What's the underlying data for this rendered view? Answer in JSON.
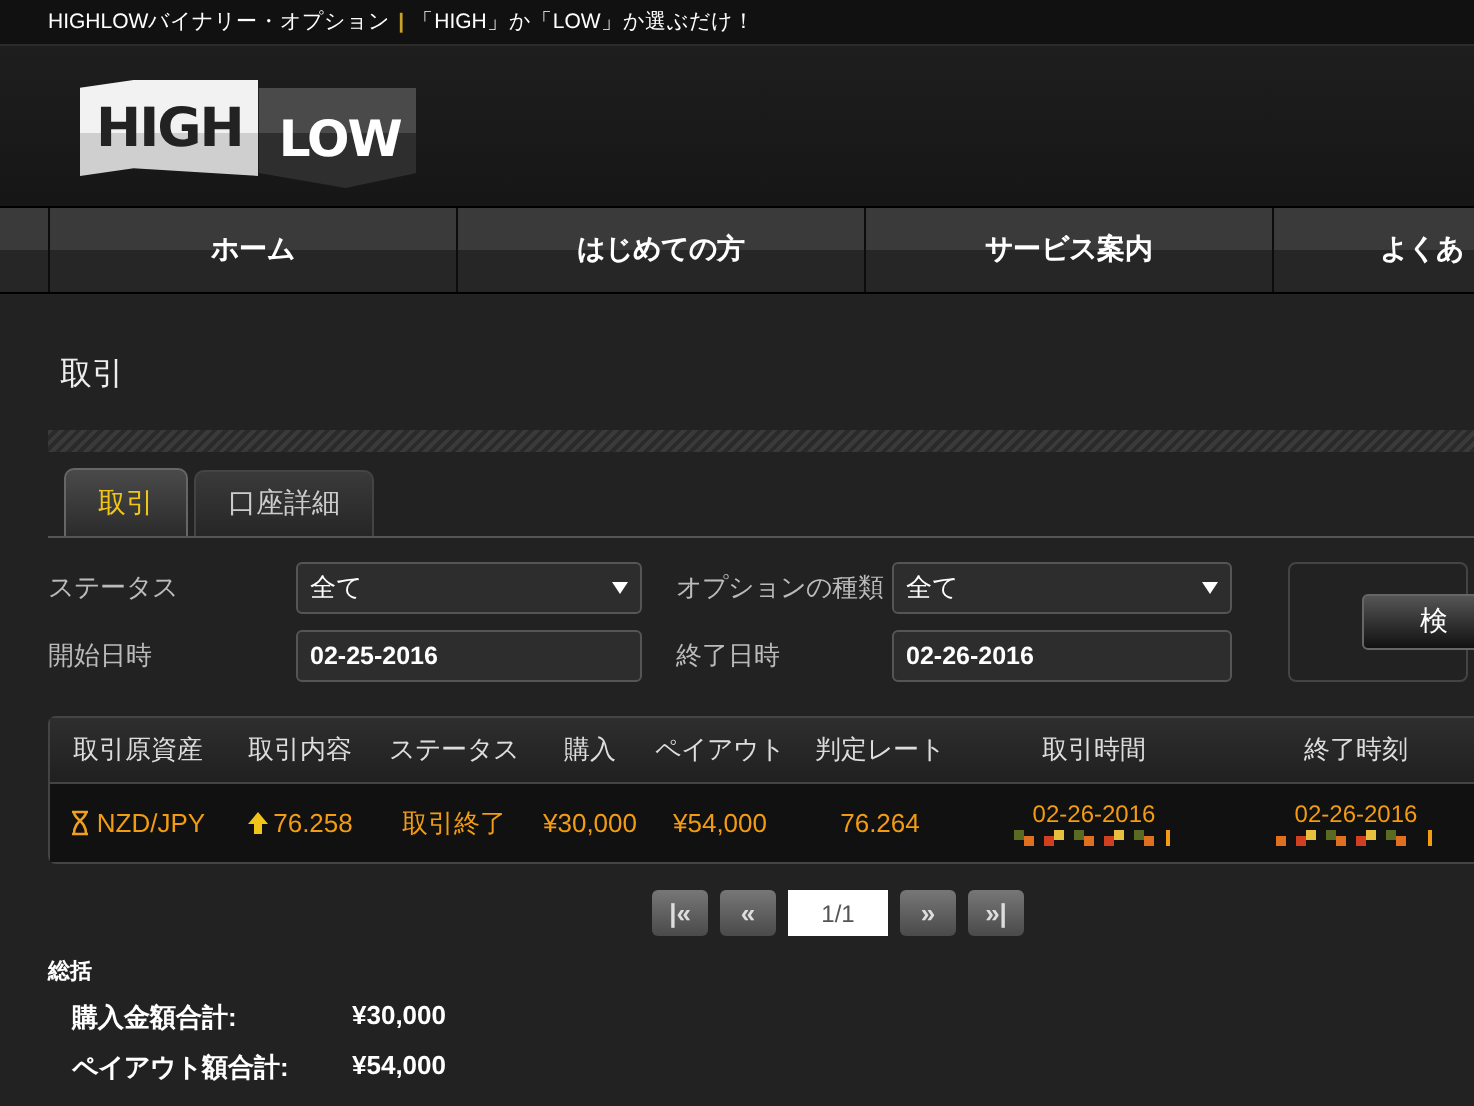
{
  "top_bar": {
    "tagline_brand": "HIGHLOWバイナリー・オプション",
    "separator": "|",
    "tagline": "「HIGH」か「LOW」か選ぶだけ！"
  },
  "logo": {
    "high": "HIGH",
    "low": "LOW"
  },
  "nav": [
    "ホーム",
    "はじめての方",
    "サービス案内",
    "よくあ"
  ],
  "page_title": "取引",
  "tabs": [
    {
      "label": "取引",
      "selected": true
    },
    {
      "label": "口座詳細",
      "selected": false
    }
  ],
  "filters": [
    {
      "label": "ステータス",
      "kind": "select",
      "value": "全て"
    },
    {
      "label": "オプションの種類",
      "kind": "select",
      "value": "全て"
    },
    {
      "label": "開始日時",
      "kind": "date",
      "value": "02-25-2016"
    },
    {
      "label": "終了日時",
      "kind": "date",
      "value": "02-26-2016"
    }
  ],
  "search_button": "検",
  "table": {
    "columns": [
      "取引原資産",
      "取引内容",
      "ステータス",
      "購入",
      "ペイアウト",
      "判定レート",
      "取引時間",
      "終了時刻"
    ],
    "rows": [
      {
        "asset": "NZD/JPY",
        "kind": "up",
        "strike": "76.258",
        "status": "取引終了",
        "purchase": "¥30,000",
        "payout": "¥54,000",
        "closing_rate": "76.264",
        "trade_time": "02-26-2016",
        "expiry_time": "02-26-2016"
      }
    ]
  },
  "pagination": {
    "first": "|«",
    "prev": "«",
    "page": "1/1",
    "next": "»",
    "last": "»|"
  },
  "summary": {
    "title": "総括",
    "items": [
      {
        "label": "購入金額合計:",
        "value": "¥30,000"
      },
      {
        "label": "ペイアウト額合計:",
        "value": "¥54,000"
      }
    ]
  }
}
